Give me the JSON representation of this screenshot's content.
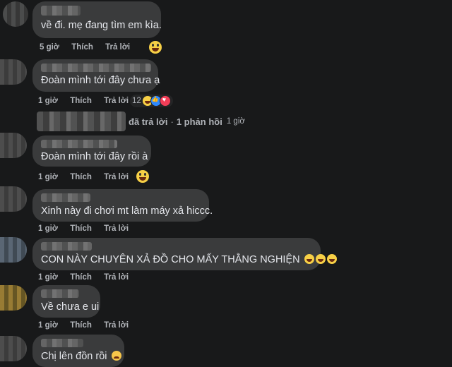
{
  "comments": [
    {
      "text": "về đi. mẹ đang tìm em kìa.",
      "time": "5 giờ",
      "like": "Thích",
      "reply": "Trả lời"
    },
    {
      "text": "Đoàn mình tới đây chưa ạ",
      "time": "1 giờ",
      "like": "Thích",
      "reply": "Trả lời",
      "reaction_count": "12"
    },
    {
      "text": "Đoàn mình tới đây rồi à",
      "time": "1 giờ",
      "like": "Thích",
      "reply": "Trả lời"
    },
    {
      "text": "Xinh này đi chơi mt làm máy xả hiccc.",
      "time": "1 giờ",
      "like": "Thích",
      "reply": "Trả lời"
    },
    {
      "text": "CON NÀY CHUYÊN XẢ ĐỒ CHO MẤY THẰNG NGHIỆN",
      "time": "1 giờ",
      "like": "Thích",
      "reply": "Trả lời"
    },
    {
      "text": "Về chưa e ui",
      "time": "1 giờ",
      "like": "Thích",
      "reply": "Trả lời"
    },
    {
      "text": "Chị lên đồn rồi",
      "time": "",
      "like": "",
      "reply": ""
    }
  ],
  "reply_summary": {
    "replied": "đã trả lời",
    "separator": "·",
    "count": "1 phản hồi",
    "time": "1 giờ"
  },
  "icons": {
    "haha": "haha-emoji-icon",
    "like": "like-reaction-icon",
    "love": "love-reaction-icon",
    "sad": "sad-emoji-icon"
  },
  "colors": {
    "background": "#18191a",
    "bubble": "#3a3b3c",
    "text": "#e4e6eb",
    "meta": "#b0b3b8"
  }
}
